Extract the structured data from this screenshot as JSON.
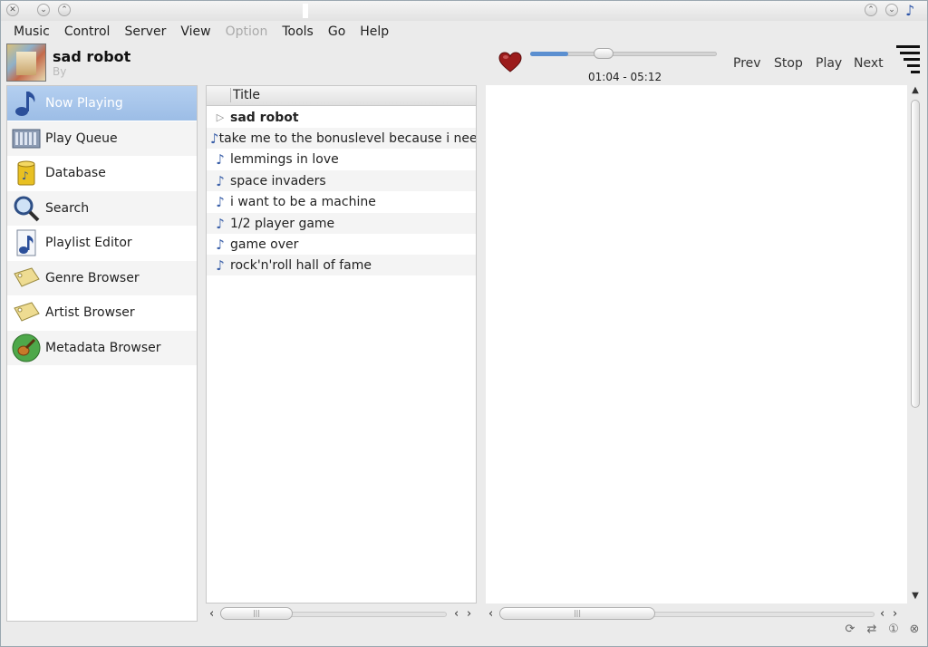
{
  "menu": [
    {
      "label": "Music",
      "disabled": false
    },
    {
      "label": "Control",
      "disabled": false
    },
    {
      "label": "Server",
      "disabled": false
    },
    {
      "label": "View",
      "disabled": false
    },
    {
      "label": "Option",
      "disabled": true
    },
    {
      "label": "Tools",
      "disabled": false
    },
    {
      "label": "Go",
      "disabled": false
    },
    {
      "label": "Help",
      "disabled": false
    }
  ],
  "now_playing": {
    "title": "sad robot",
    "artist": "By",
    "time": "01:04 - 05:12",
    "progress": 0.205
  },
  "controls": {
    "prev": "Prev",
    "stop": "Stop",
    "play": "Play",
    "next": "Next"
  },
  "sidebar": {
    "items": [
      {
        "label": "Now Playing",
        "icon": "music-note-icon"
      },
      {
        "label": "Play Queue",
        "icon": "queue-icon"
      },
      {
        "label": "Database",
        "icon": "database-icon"
      },
      {
        "label": "Search",
        "icon": "search-icon"
      },
      {
        "label": "Playlist Editor",
        "icon": "playlist-icon"
      },
      {
        "label": "Genre Browser",
        "icon": "tag-icon"
      },
      {
        "label": "Artist Browser",
        "icon": "tag-icon"
      },
      {
        "label": "Metadata Browser",
        "icon": "guitar-icon"
      }
    ]
  },
  "playlist": {
    "column_title": "Title",
    "rows": [
      {
        "title": "sad robot",
        "playing": true
      },
      {
        "title": "take me to the bonuslevel because i need",
        "playing": false
      },
      {
        "title": "lemmings in love",
        "playing": false
      },
      {
        "title": "space invaders",
        "playing": false
      },
      {
        "title": "i want to be a machine",
        "playing": false
      },
      {
        "title": "1/2 player game",
        "playing": false
      },
      {
        "title": "game over",
        "playing": false
      },
      {
        "title": "rock'n'roll hall of fame",
        "playing": false
      }
    ]
  },
  "colors": {
    "accent": "#5b8fd0",
    "selected": "#a9c7ec",
    "heart": "#9b1b1b"
  }
}
